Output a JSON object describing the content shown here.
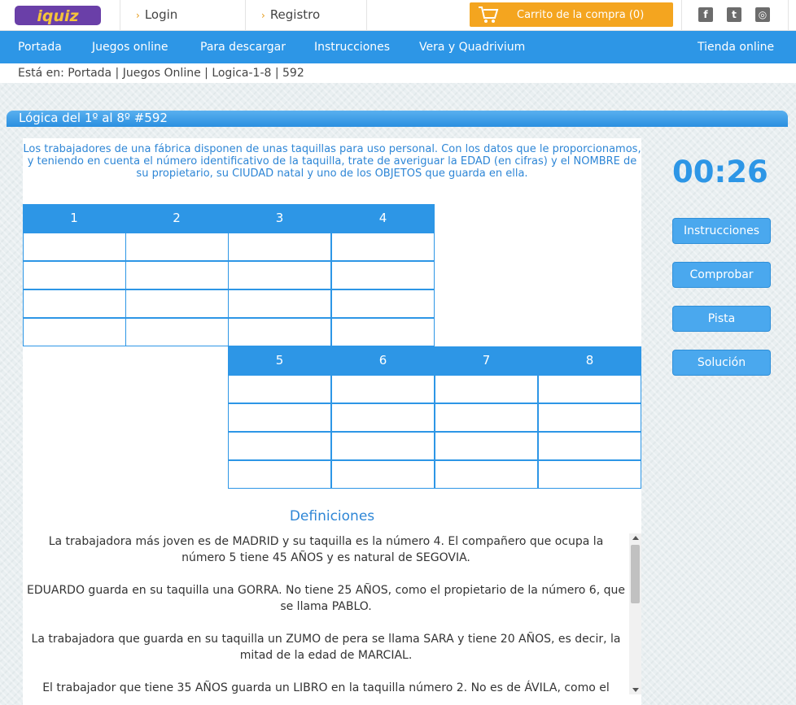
{
  "brand": {
    "logo_text": "iquiz"
  },
  "topbar": {
    "login": "Login",
    "register": "Registro",
    "cart": "Carrito de la compra (0)",
    "social": {
      "facebook": "f",
      "twitter": "t",
      "instagram": "◎"
    }
  },
  "nav": {
    "items": [
      "Portada",
      "Juegos online",
      "Para descargar",
      "Instrucciones",
      "Vera y Quadrivium"
    ],
    "shop": "Tienda online"
  },
  "breadcrumb": "Está en: Portada | Juegos Online | Logica-1-8 | 592",
  "puzzle": {
    "title": "Lógica del 1º al 8º #592",
    "intro": "Los trabajadores de una fábrica disponen de unas taquillas para uso personal. Con los datos que le proporcionamos, y teniendo en cuenta el número identificativo de la taquilla, trate de averiguar la EDAD (en cifras) y el NOMBRE de su propietario, su CIUDAD natal y uno de los OBJETOS que guarda en ella.",
    "grid_top_headers": [
      "1",
      "2",
      "3",
      "4"
    ],
    "grid_bottom_headers": [
      "5",
      "6",
      "7",
      "8"
    ],
    "definitions_title": "Definiciones",
    "definitions": [
      "La trabajadora más joven es de MADRID y su taquilla es la número 4. El compañero que ocupa la número 5 tiene 45 AÑOS y es natural de SEGOVIA.",
      "EDUARDO guarda en su taquilla una GORRA. No tiene 25 AÑOS, como el propietario de la número 6, que se llama PABLO.",
      "La trabajadora que guarda en su taquilla un ZUMO de pera se llama SARA y tiene 20 AÑOS, es decir, la mitad de la edad de MARCIAL.",
      "El trabajador que tiene 35 AÑOS guarda un LIBRO en la taquilla número 2. No es de ÁVILA, como el"
    ]
  },
  "sidebar": {
    "timer": "00:26",
    "buttons": [
      "Instrucciones",
      "Comprobar",
      "Pista",
      "Solución"
    ]
  },
  "colors": {
    "primary": "#2d96e6",
    "accent": "#f4a51f",
    "text": "#333333"
  }
}
